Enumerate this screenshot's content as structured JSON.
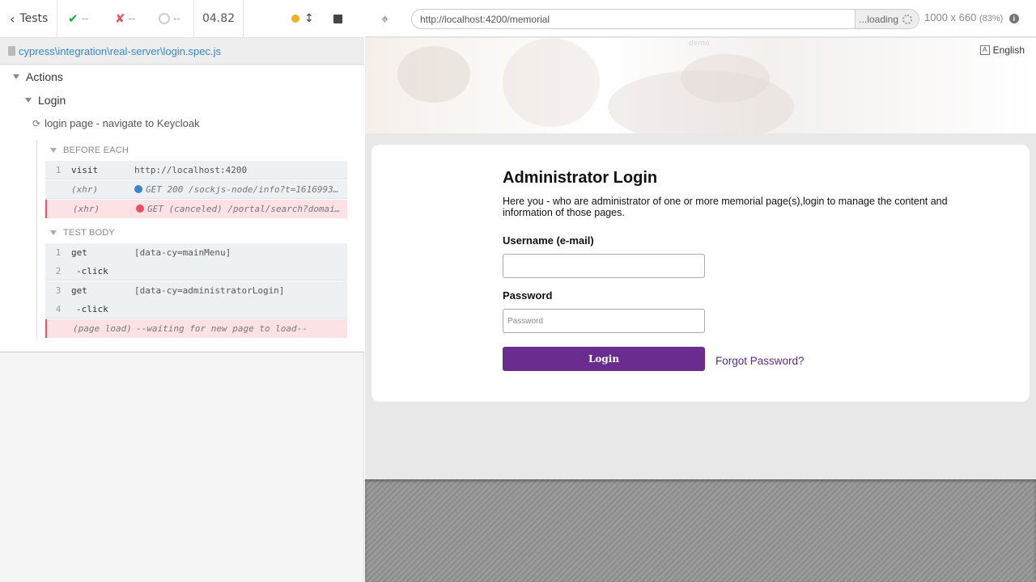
{
  "reporter": {
    "header": {
      "back_label": "Tests",
      "passed": "--",
      "failed": "--",
      "pending": "--",
      "duration": "04.82"
    },
    "spec_path": "cypress\\integration\\real-server\\login.spec.js",
    "tree": {
      "suite": "Actions",
      "subsuite": "Login",
      "test": "login page - navigate to Keycloak"
    },
    "before_each": {
      "title": "BEFORE EACH",
      "commands": [
        {
          "num": "1",
          "name": "visit",
          "message": "http://localhost:4200"
        },
        {
          "num": "",
          "name": "(xhr)",
          "message": "GET 200 /sockjs-node/info?t=1616993…",
          "dot_color": "#3a86c8"
        },
        {
          "num": "",
          "name": "(xhr)",
          "message": "GET (canceled) /portal/search?domai…",
          "dot_color": "#e94f5f"
        }
      ]
    },
    "test_body": {
      "title": "TEST BODY",
      "commands": [
        {
          "num": "1",
          "name": "get",
          "message": "[data-cy=mainMenu]"
        },
        {
          "num": "2",
          "name": "-click",
          "message": ""
        },
        {
          "num": "3",
          "name": "get",
          "message": "[data-cy=administratorLogin]"
        },
        {
          "num": "4",
          "name": "-click",
          "message": ""
        },
        {
          "num": "",
          "name": "(page load)",
          "message": "--waiting for new page to load--"
        }
      ]
    }
  },
  "aut": {
    "url": "http://localhost:4200/memorial",
    "loading_label": "...loading",
    "viewport_size": "1000 x 660",
    "viewport_scale": "(83%)",
    "page": {
      "demo_mark": "demo",
      "language": "English",
      "title": "Administrator Login",
      "intro": "Here you - who are administrator of one or more memorial page(s),login to manage the content and information of those pages.",
      "username_label": "Username (e-mail)",
      "username_value": "",
      "password_label": "Password",
      "password_placeholder": "Password",
      "login_button": "Login",
      "forgot_link": "Forgot Password?"
    }
  },
  "colors": {
    "pass": "#1aa84f",
    "fail": "#e94f5f",
    "running_dot": "#f2b01c",
    "spec_link": "#3386d4",
    "login_button": "#6a2c8e",
    "link_purple": "#5b2a83"
  }
}
